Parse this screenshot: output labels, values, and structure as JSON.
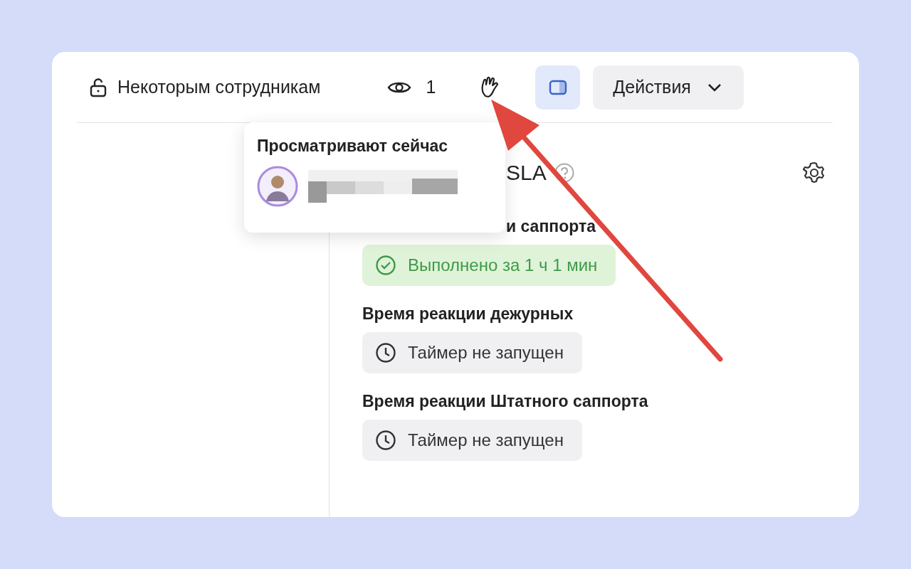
{
  "toolbar": {
    "access": {
      "label": "Некоторым сотрудникам"
    },
    "viewers": {
      "count": "1"
    },
    "panel_toggle": {
      "selected": true
    },
    "actions": {
      "label": "Действия"
    }
  },
  "viewers_popup": {
    "title": "Просматривают сейчас",
    "viewers": [
      {
        "kind": "user"
      }
    ]
  },
  "sla_panel": {
    "heading": "SLA",
    "timers": [
      {
        "label": "и саппорта",
        "kind": "done",
        "text": "Выполнено за 1 ч 1 мин"
      },
      {
        "label": "Время реакции дежурных",
        "kind": "idle",
        "text": "Таймер не запущен"
      },
      {
        "label": "Время реакции Штатного саппорта",
        "kind": "idle",
        "text": "Таймер не запущен"
      }
    ]
  }
}
